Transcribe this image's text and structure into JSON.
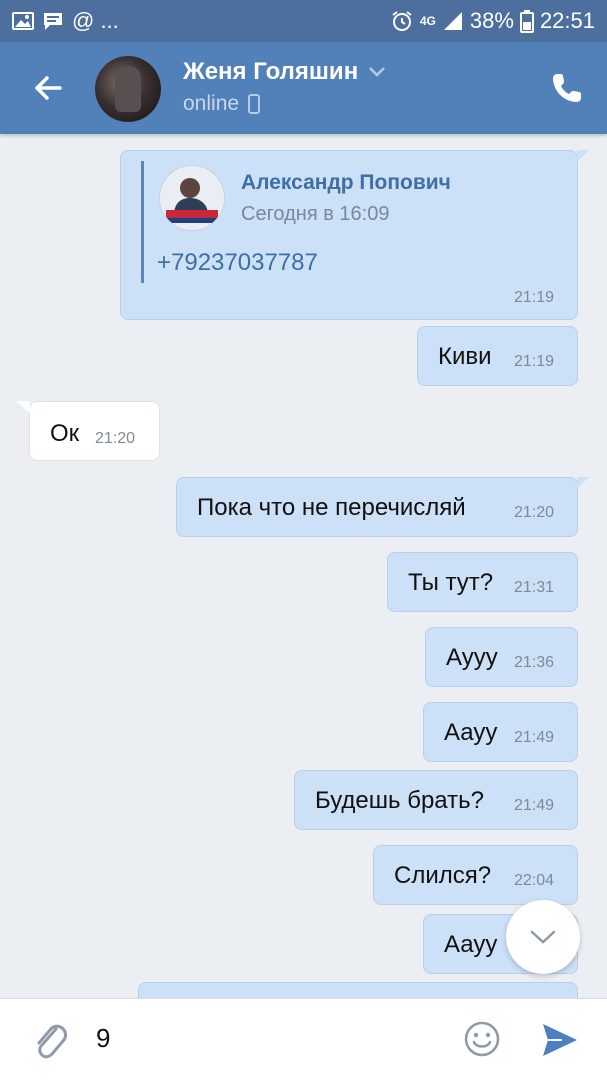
{
  "status_bar": {
    "notification_text": "@ ...",
    "network": "4G",
    "battery": "38%",
    "time": "22:51"
  },
  "header": {
    "name": "Женя Голяшин",
    "status": "online"
  },
  "forwarded": {
    "author": "Александр Попович",
    "date": "Сегодня в 16:09",
    "phone": "+79237037787",
    "time": "21:19"
  },
  "messages": [
    {
      "text": "Киви",
      "time": "21:19",
      "direction": "out"
    },
    {
      "text": "Ок",
      "time": "21:20",
      "direction": "in"
    },
    {
      "text": "Пока что не перечисляй",
      "time": "21:20",
      "direction": "out"
    },
    {
      "text": "Ты тут?",
      "time": "21:31",
      "direction": "out"
    },
    {
      "text": "Аууу",
      "time": "21:36",
      "direction": "out"
    },
    {
      "text": "Аауу",
      "time": "21:49",
      "direction": "out"
    },
    {
      "text": "Будешь брать?",
      "time": "21:49",
      "direction": "out"
    },
    {
      "text": "Слился?",
      "time": "22:04",
      "direction": "out"
    },
    {
      "text": "Аауу",
      "time": "",
      "direction": "out"
    }
  ],
  "composer": {
    "value": "9"
  },
  "colors": {
    "status_bar": "#4d6f9e",
    "header": "#5181b8",
    "outgoing_bubble": "#cce0f7",
    "incoming_bubble": "#ffffff",
    "chat_background": "#ebeef2",
    "send_icon": "#4a7fc1"
  },
  "icons": {
    "back": "arrow-left-icon",
    "call": "phone-icon",
    "attach": "paperclip-icon",
    "emoji": "smiley-icon",
    "send": "send-icon",
    "scroll_down": "chevron-down-icon"
  }
}
